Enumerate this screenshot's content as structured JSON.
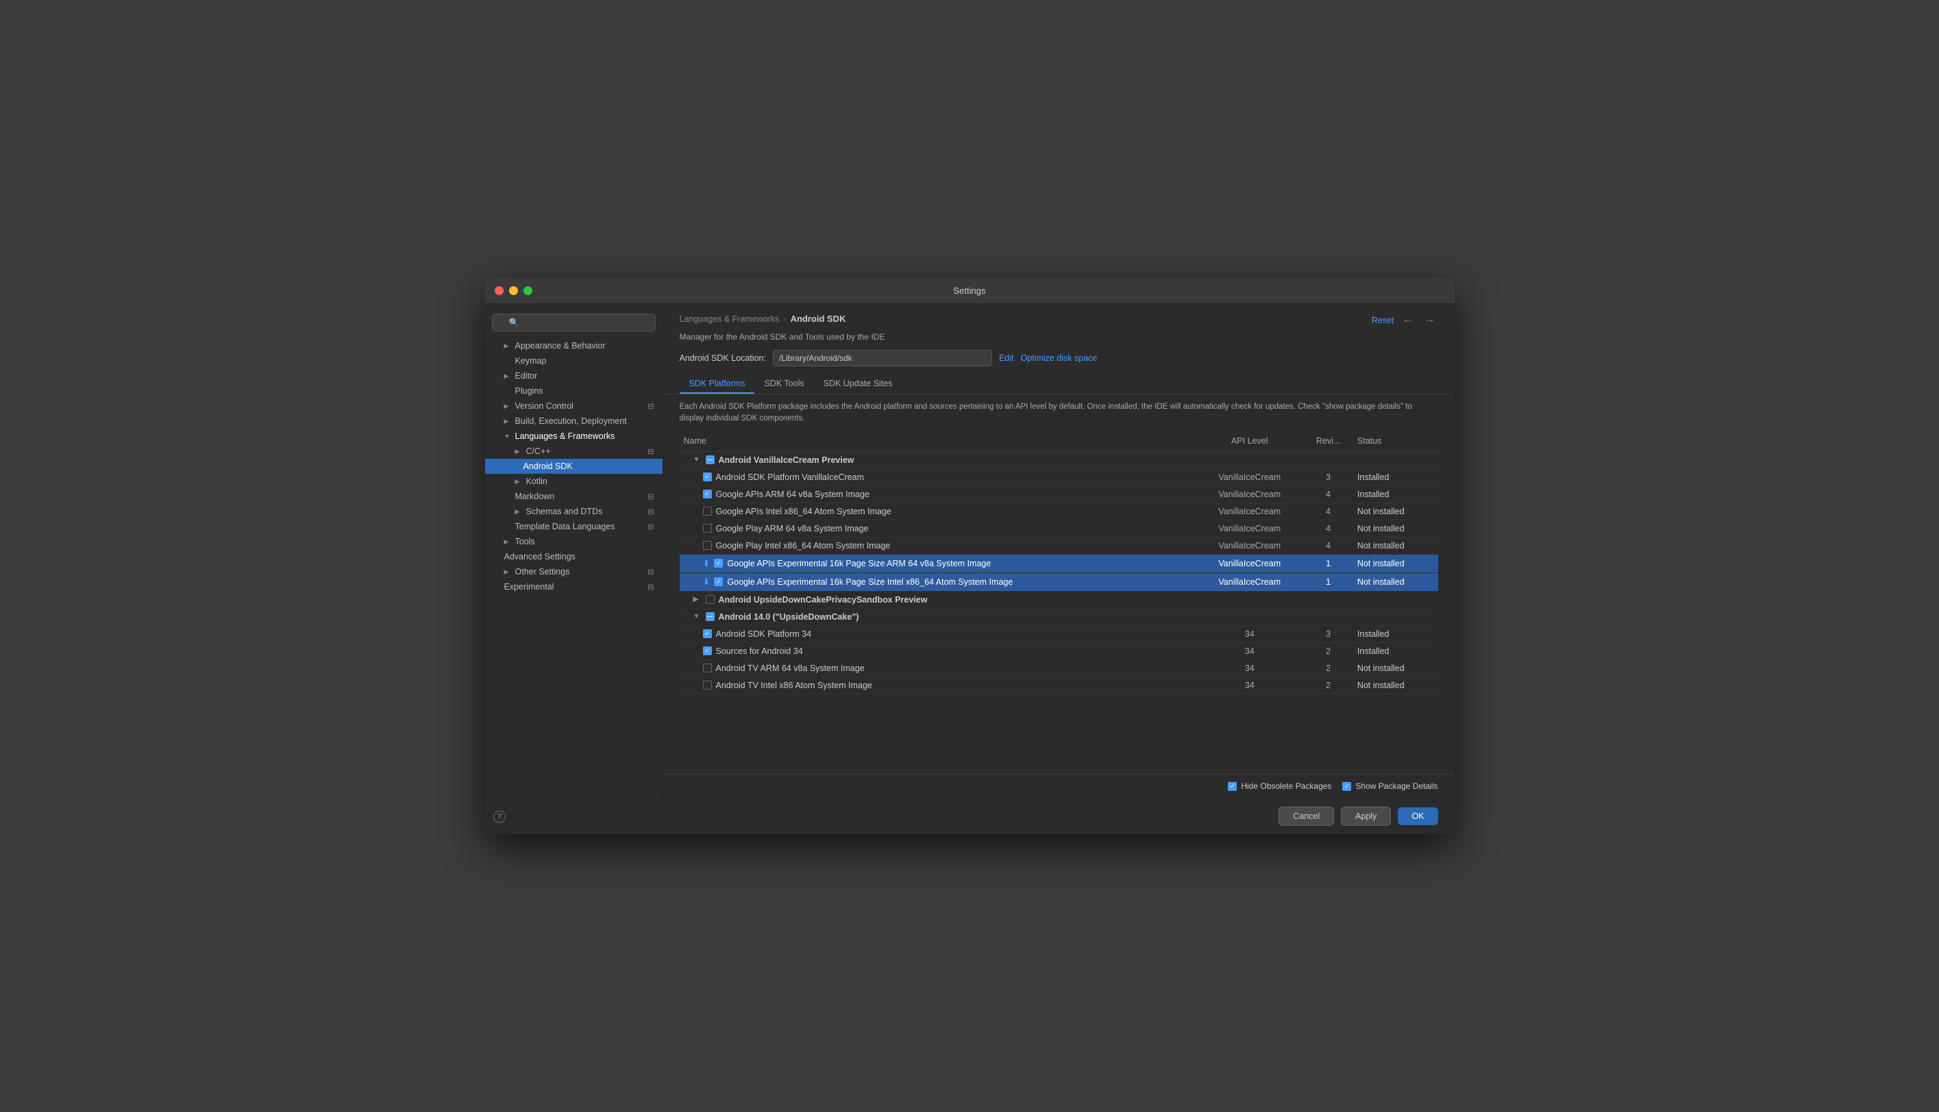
{
  "window": {
    "title": "Settings"
  },
  "sidebar": {
    "search_placeholder": "🔍",
    "items": [
      {
        "id": "appearance",
        "label": "Appearance & Behavior",
        "level": 0,
        "has_arrow": true,
        "bold": false
      },
      {
        "id": "keymap",
        "label": "Keymap",
        "level": 1,
        "has_arrow": false,
        "bold": false
      },
      {
        "id": "editor",
        "label": "Editor",
        "level": 0,
        "has_arrow": true,
        "bold": false
      },
      {
        "id": "plugins",
        "label": "Plugins",
        "level": 1,
        "has_arrow": false,
        "bold": false
      },
      {
        "id": "version-control",
        "label": "Version Control",
        "level": 0,
        "has_arrow": true,
        "bold": false
      },
      {
        "id": "build",
        "label": "Build, Execution, Deployment",
        "level": 0,
        "has_arrow": true,
        "bold": false
      },
      {
        "id": "languages",
        "label": "Languages & Frameworks",
        "level": 0,
        "has_arrow": false,
        "expanded": true,
        "bold": false
      },
      {
        "id": "cpp",
        "label": "C/C++",
        "level": 1,
        "has_arrow": true,
        "bold": false
      },
      {
        "id": "android-sdk",
        "label": "Android SDK",
        "level": 2,
        "has_arrow": false,
        "active": true,
        "bold": false
      },
      {
        "id": "kotlin",
        "label": "Kotlin",
        "level": 1,
        "has_arrow": true,
        "bold": false
      },
      {
        "id": "markdown",
        "label": "Markdown",
        "level": 1,
        "has_arrow": false,
        "bold": false
      },
      {
        "id": "schemas",
        "label": "Schemas and DTDs",
        "level": 1,
        "has_arrow": true,
        "bold": false
      },
      {
        "id": "template",
        "label": "Template Data Languages",
        "level": 1,
        "has_arrow": false,
        "bold": false
      },
      {
        "id": "tools",
        "label": "Tools",
        "level": 0,
        "has_arrow": true,
        "bold": false
      },
      {
        "id": "advanced",
        "label": "Advanced Settings",
        "level": 0,
        "has_arrow": false,
        "bold": false
      },
      {
        "id": "other",
        "label": "Other Settings",
        "level": 0,
        "has_arrow": true,
        "bold": false
      },
      {
        "id": "experimental",
        "label": "Experimental",
        "level": 0,
        "has_arrow": false,
        "bold": false
      }
    ]
  },
  "panel": {
    "breadcrumb_parent": "Languages & Frameworks",
    "breadcrumb_current": "Android SDK",
    "reset_label": "Reset",
    "description": "Manager for the Android SDK and Tools used by the IDE",
    "sdk_location_label": "Android SDK Location:",
    "sdk_location_value": "/Library/Android/sdk",
    "edit_label": "Edit",
    "optimize_label": "Optimize disk space",
    "tabs": [
      {
        "id": "platforms",
        "label": "SDK Platforms",
        "active": true
      },
      {
        "id": "tools",
        "label": "SDK Tools",
        "active": false
      },
      {
        "id": "update-sites",
        "label": "SDK Update Sites",
        "active": false
      }
    ],
    "table_description": "Each Android SDK Platform package includes the Android platform and sources pertaining to an API level by default. Once installed, the IDE will automatically check for updates. Check \"show package details\" to display individual SDK components.",
    "columns": {
      "name": "Name",
      "api": "API Level",
      "revision": "Revi...",
      "status": "Status"
    },
    "rows": [
      {
        "id": "vanilla-group",
        "type": "group-expanded",
        "indent": 0,
        "checkbox": "indeterminate",
        "name": "Android VanillaIceCream Preview",
        "api": "",
        "revision": "",
        "status": ""
      },
      {
        "id": "vanilla-platform",
        "type": "item",
        "indent": 1,
        "checkbox": "checked",
        "name": "Android SDK Platform VanillaIceCream",
        "api": "VanillaIceCream",
        "revision": "3",
        "status": "Installed"
      },
      {
        "id": "vanilla-apis-arm",
        "type": "item",
        "indent": 1,
        "checkbox": "checked",
        "name": "Google APIs ARM 64 v8a System Image",
        "api": "VanillaIceCream",
        "revision": "4",
        "status": "Installed"
      },
      {
        "id": "vanilla-apis-intel",
        "type": "item",
        "indent": 1,
        "checkbox": "unchecked",
        "name": "Google APIs Intel x86_64 Atom System Image",
        "api": "VanillaIceCream",
        "revision": "4",
        "status": "Not installed"
      },
      {
        "id": "vanilla-play-arm",
        "type": "item",
        "indent": 1,
        "checkbox": "unchecked",
        "name": "Google Play ARM 64 v8a System Image",
        "api": "VanillaIceCream",
        "revision": "4",
        "status": "Not installed"
      },
      {
        "id": "vanilla-play-intel",
        "type": "item",
        "indent": 1,
        "checkbox": "unchecked",
        "name": "Google Play Intel x86_64 Atom System Image",
        "api": "VanillaIceCream",
        "revision": "4",
        "status": "Not installed"
      },
      {
        "id": "vanilla-exp-arm",
        "type": "item-selected",
        "indent": 1,
        "checkbox": "checked",
        "download": true,
        "name": "Google APIs Experimental 16k Page Size ARM 64 v8a System Image",
        "api": "VanillaIceCream",
        "revision": "1",
        "status": "Not installed"
      },
      {
        "id": "vanilla-exp-intel",
        "type": "item-selected",
        "indent": 1,
        "checkbox": "checked",
        "download": true,
        "name": "Google APIs Experimental 16k Page Size Intel x86_64 Atom System Image",
        "api": "VanillaIceCream",
        "revision": "1",
        "status": "Not installed"
      },
      {
        "id": "upsidedown-group",
        "type": "group-collapsed",
        "indent": 0,
        "checkbox": "unchecked",
        "name": "Android UpsideDownCakePrivacySandbox Preview",
        "api": "",
        "revision": "",
        "status": ""
      },
      {
        "id": "android14-group",
        "type": "group-expanded",
        "indent": 0,
        "checkbox": "indeterminate",
        "name": "Android 14.0 (\"UpsideDownCake\")",
        "api": "",
        "revision": "",
        "status": ""
      },
      {
        "id": "android14-platform",
        "type": "item",
        "indent": 1,
        "checkbox": "checked",
        "name": "Android SDK Platform 34",
        "api": "34",
        "revision": "3",
        "status": "Installed"
      },
      {
        "id": "android14-sources",
        "type": "item",
        "indent": 1,
        "checkbox": "checked",
        "name": "Sources for Android 34",
        "api": "34",
        "revision": "2",
        "status": "Installed"
      },
      {
        "id": "android14-tv-arm",
        "type": "item",
        "indent": 1,
        "checkbox": "unchecked",
        "name": "Android TV ARM 64 v8a System Image",
        "api": "34",
        "revision": "2",
        "status": "Not installed"
      },
      {
        "id": "android14-tv-intel",
        "type": "item",
        "indent": 1,
        "checkbox": "unchecked",
        "name": "Android TV Intel x86 Atom System Image",
        "api": "34",
        "revision": "2",
        "status": "Not installed"
      }
    ],
    "footer": {
      "hide_obsolete_checked": true,
      "hide_obsolete_label": "Hide Obsolete Packages",
      "show_details_checked": true,
      "show_details_label": "Show Package Details"
    },
    "buttons": {
      "cancel": "Cancel",
      "apply": "Apply",
      "ok": "OK"
    }
  }
}
